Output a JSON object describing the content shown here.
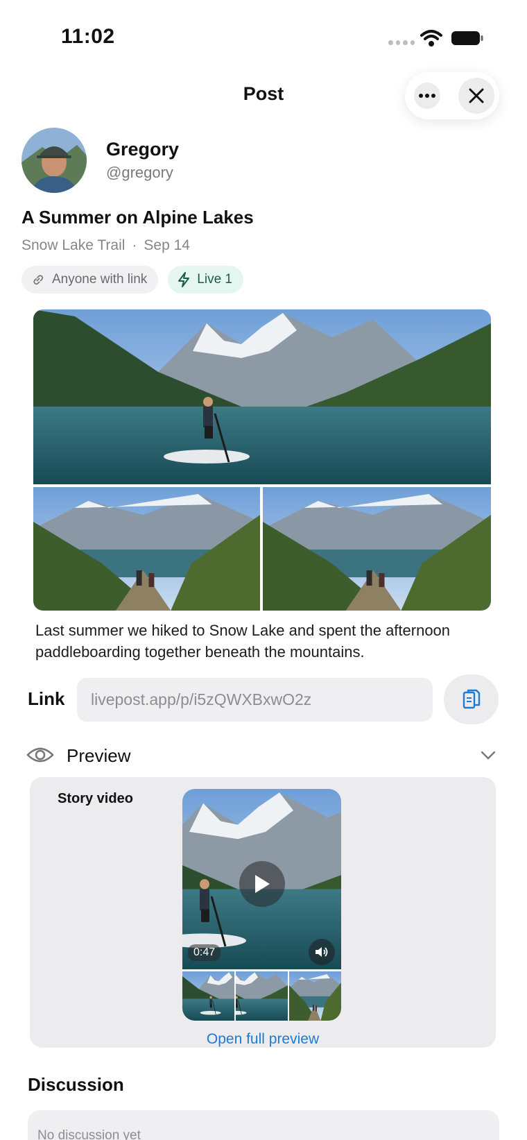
{
  "status_bar": {
    "time": "11:02"
  },
  "header": {
    "title": "Post",
    "more_icon": "more-dots-icon",
    "close_icon": "close-icon"
  },
  "author": {
    "name": "Gregory",
    "handle": "@gregory"
  },
  "post": {
    "title": "A Summer on Alpine Lakes",
    "location": "Snow Lake Trail",
    "separator": "·",
    "date": "Sep 14",
    "chips": {
      "share": "Anyone with link",
      "live": "Live 1"
    },
    "caption": "Last summer we hiked to Snow Lake and spent the afternoon paddleboarding together beneath the mountains."
  },
  "link": {
    "label": "Link",
    "value": "livepost.app/p/i5zQWXBxwO2z"
  },
  "preview": {
    "label": "Preview",
    "story_label": "Story video",
    "duration": "0:47",
    "open_label": "Open full preview"
  },
  "discussion": {
    "title": "Discussion",
    "empty": "No discussion yet"
  },
  "colors": {
    "accent_blue": "#1d7ad4",
    "live_green": "#1a5c48",
    "live_bg": "#e5f5ef"
  }
}
